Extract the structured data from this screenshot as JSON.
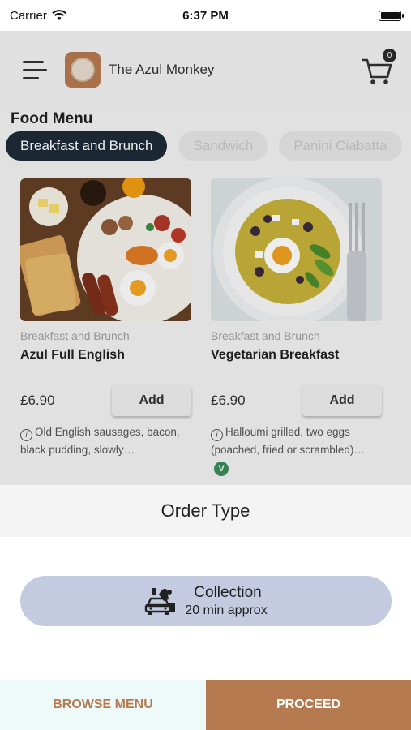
{
  "status_bar": {
    "carrier": "Carrier",
    "time": "6:37 PM"
  },
  "header": {
    "brand": "The Azul Monkey",
    "cart_count": "0"
  },
  "menu": {
    "title": "Food Menu",
    "categories": [
      {
        "label": "Breakfast and Brunch",
        "active": true
      },
      {
        "label": "Sandwich",
        "active": false
      },
      {
        "label": "Panini Ciabatta",
        "active": false
      }
    ],
    "items": [
      {
        "category": "Breakfast and Brunch",
        "name": "Azul Full English",
        "price": "£6.90",
        "add_label": "Add",
        "description": "Old English sausages, bacon, black pudding, slowly…"
      },
      {
        "category": "Breakfast and Brunch",
        "name": "Vegetarian Breakfast",
        "price": "£6.90",
        "add_label": "Add",
        "description": "Halloumi grilled, two eggs (poached, fried or scrambled)…",
        "badge": "V"
      }
    ]
  },
  "order_sheet": {
    "title": "Order Type",
    "option": {
      "title": "Collection",
      "subtitle": "20 min approx",
      "icon": "car-collection-icon"
    },
    "browse_label": "BROWSE MENU",
    "proceed_label": "PROCEED"
  },
  "colors": {
    "accent": "#b57a4f",
    "chip_active": "#1f2a38",
    "option_bg": "#c4cbe0"
  }
}
